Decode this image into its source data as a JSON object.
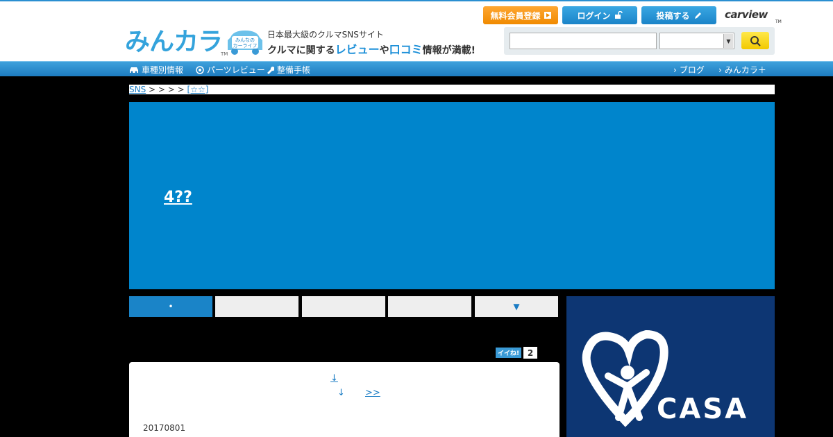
{
  "header": {
    "logo_text": "みんカラ",
    "logo_tm": "TM",
    "carlife_line1": "みんなの",
    "carlife_line2": "カーライフ",
    "tagline1": "日本最大級のクルマSNSサイト",
    "tagline2_a": "クルマに関する",
    "tagline2_review": "レビュー",
    "tagline2_b": "や",
    "tagline2_kuchikomi": "口コミ",
    "tagline2_c": "情報が満載!",
    "register_label": "無料会員登録",
    "login_label": "ログイン",
    "post_label": "投稿する",
    "carview_label": "carview",
    "carview_tm": "TM"
  },
  "search": {
    "query": "",
    "category": ""
  },
  "nav": {
    "left": [
      "車種別情報",
      "パーツレビュー",
      "整備手帳"
    ],
    "right": [
      "ブログ",
      "みんカラ＋"
    ]
  },
  "breadcrumb": {
    "root": "SNS",
    "separators": "> > > >",
    "current": "[☆☆]"
  },
  "hero": {
    "title": "4??"
  },
  "tabs": [
    {
      "label": "•",
      "active": true
    },
    {
      "label": "",
      "active": false
    },
    {
      "label": "",
      "active": false
    },
    {
      "label": "",
      "active": false
    },
    {
      "label": "▼",
      "active": false
    }
  ],
  "iine": {
    "badge": "イイね!",
    "count": "2"
  },
  "content": {
    "link_up": "↓",
    "link_down": "↓",
    "link_next": ">>",
    "date": "20170801"
  },
  "ad": {
    "brand": "CASA",
    "registered": "®",
    "bg_color": "#0d3673"
  },
  "colors": {
    "accent": "#0085cc",
    "orange": "#f08a00",
    "nav": "#1d7cc0"
  }
}
